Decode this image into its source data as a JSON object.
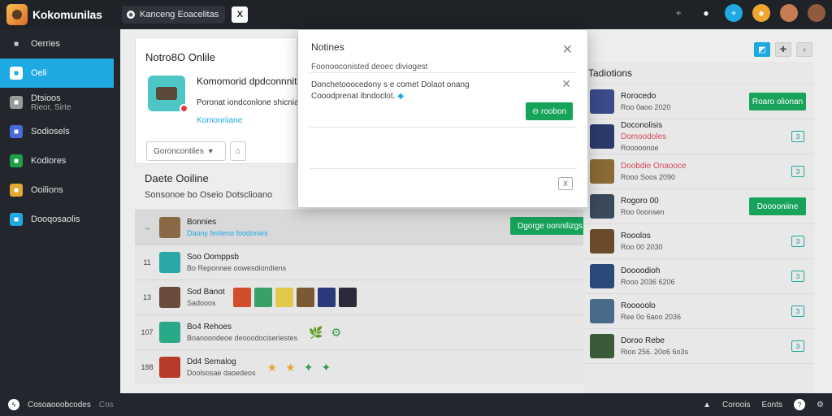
{
  "app": {
    "brand": "Kokomunilas",
    "search_chip": "Kanceng Eoacelitas",
    "close_glyph": "X"
  },
  "topbar": {
    "icons": [
      {
        "name": "add-icon",
        "glyph": "+",
        "bg": "#1f2227",
        "color": "#aaaaaa"
      },
      {
        "name": "user-icon",
        "glyph": "●",
        "bg": "#1f2227",
        "color": "#ffffff"
      },
      {
        "name": "new-chat-icon",
        "glyph": "+",
        "bg": "#1ea9e3",
        "color": "#ffffff"
      },
      {
        "name": "notification-icon",
        "glyph": "●",
        "bg": "#f0a531",
        "color": "#ffffff"
      },
      {
        "name": "avatar-1",
        "glyph": "",
        "bg": "#c77d54",
        "color": "#ffffff"
      },
      {
        "name": "avatar-2",
        "glyph": "",
        "bg": "#8f5a3e",
        "color": "#ffffff"
      }
    ]
  },
  "sidebar": {
    "items": [
      {
        "label": "Oerries",
        "sub": "",
        "icon": "phone-icon",
        "icon_bg": "#23262c",
        "icon_color": "#cccccc",
        "active": false
      },
      {
        "label": "Oeli",
        "sub": "",
        "icon": "window-icon",
        "icon_bg": "#ffffff",
        "icon_color": "#1ea9e3",
        "active": true
      },
      {
        "label": "Dtsioos",
        "sub": "Rieor, Sirte",
        "icon": "grid-icon",
        "icon_bg": "#9a9a9a",
        "icon_color": "#ffffff",
        "active": false
      },
      {
        "label": "Sodiosels",
        "sub": "",
        "icon": "puzzle-icon",
        "icon_bg": "#4a6ad8",
        "icon_color": "#ffffff",
        "active": false
      },
      {
        "label": "Kodiores",
        "sub": "",
        "icon": "chat-icon",
        "icon_bg": "#1f9e4a",
        "icon_color": "#ffffff",
        "active": false
      },
      {
        "label": "Ooilions",
        "sub": "",
        "icon": "gallery-icon",
        "icon_bg": "#e2a833",
        "icon_color": "#ffffff",
        "active": false
      },
      {
        "label": "Dooqosaolis",
        "sub": "",
        "icon": "globe-icon",
        "icon_bg": "#1ea9e3",
        "icon_color": "#ffffff",
        "active": false
      }
    ]
  },
  "panel": {
    "title": "Notro8O Onlile",
    "game_title": "Komomorid dpdconnnit",
    "game_sub": "Poronat iondconlone shicnia",
    "game_link": "Komonriiane",
    "select_label": "Goroncontiles",
    "lock_glyph": "⌂"
  },
  "section2": {
    "title": "Daete Ooiline",
    "subtitle": "Sonsonoe bo Oseio Dotsclioano"
  },
  "rows": [
    {
      "num": "→",
      "thumb": "#8a6a45",
      "l1": "Bonnies",
      "l2": "Daony fenleno foodonies",
      "l2_link": true,
      "tiles": [],
      "icons": [],
      "button": "Dgorge oonnilizgs"
    },
    {
      "num": "11",
      "thumb": "#2aa6a6",
      "l1": "Soo Oomppsb",
      "l2": "Bo Reponnee oowesdiondiens",
      "l2_link": false,
      "tiles": [],
      "icons": [],
      "button": ""
    },
    {
      "num": "13",
      "thumb": "#6a4a3a",
      "l1": "Sod Banot",
      "l2": "Sadooos",
      "l2_link": false,
      "tiles": [
        "#d14d2d",
        "#3aa06a",
        "#e2c84a",
        "#7a5a35",
        "#2a3a7a",
        "#2a2a3a"
      ],
      "icons": [],
      "button": ""
    },
    {
      "num": "107",
      "thumb": "#2aa88a",
      "l1": "Bo4 Rehoes",
      "l2": "Boanoondeoe deooodociseriestes",
      "l2_link": false,
      "tiles": [],
      "icons": [
        "🌿",
        "⚙"
      ],
      "button": ""
    },
    {
      "num": "188",
      "thumb": "#b83a2a",
      "l1": "Dd4 Semalog",
      "l2": "Doolsosae daoedeos",
      "l2_link": false,
      "tiles": [],
      "icons": [
        "★",
        "★",
        "✦",
        "✦"
      ],
      "button": ""
    }
  ],
  "notifications": {
    "title": "Tadiotions",
    "rows": [
      {
        "thumb": "#3a4a8a",
        "l1": "Rorocedo",
        "l1_red": false,
        "l2": "Roo 0aoo 2020",
        "action": "button",
        "label": "Roaro olionan"
      },
      {
        "thumb": "#2a3a6a",
        "l1": "Doconolisis",
        "l1_red": false,
        "l2": "Rooooonoe",
        "l1b": "Domoodoles",
        "action": "check",
        "label": "3"
      },
      {
        "thumb": "#8a6a35",
        "l1": "Doobdie Onaooce",
        "l1_red": true,
        "l2": "Rooo Soos 2090",
        "action": "check",
        "label": "3"
      },
      {
        "thumb": "#3a4a5a",
        "l1": "Rogoro 00",
        "l1_red": false,
        "l2": "Roo 0oonsen",
        "action": "button",
        "label": "Dooooniine"
      },
      {
        "thumb": "#6a4a2a",
        "l1": "Rooolos",
        "l1_red": false,
        "l2": "Roo 00 2030",
        "action": "check",
        "label": "3"
      },
      {
        "thumb": "#2a4a7a",
        "l1": "Doooodioh",
        "l1_red": false,
        "l2": "Rooo 2036 6206",
        "action": "check",
        "label": "3"
      },
      {
        "thumb": "#4a6a8a",
        "l1": "Rooooolo",
        "l1_red": false,
        "l2": "Ree 0o 6aoo 2036",
        "action": "check",
        "label": "3"
      },
      {
        "thumb": "#3a5a3a",
        "l1": "Doroo Rebe",
        "l1_red": false,
        "l2": "Rioo 256. 20o6 6o3s",
        "action": "check",
        "label": "3"
      }
    ]
  },
  "modal": {
    "title": "Notines",
    "close": "✕",
    "line1": "Foonooconisted deoec diviogest",
    "line2": "Donchetooocedony s e comet Dolaot onang",
    "line3": "Cooodprenat ibndoclot.",
    "info_glyph": "◆",
    "close2": "✕",
    "button": "⊖ roobon",
    "x_label": "X"
  },
  "footer": {
    "left_text": "Cosoaooobcodes",
    "left_sub": "Cos",
    "right": [
      "Coroois",
      "Eonts"
    ]
  }
}
